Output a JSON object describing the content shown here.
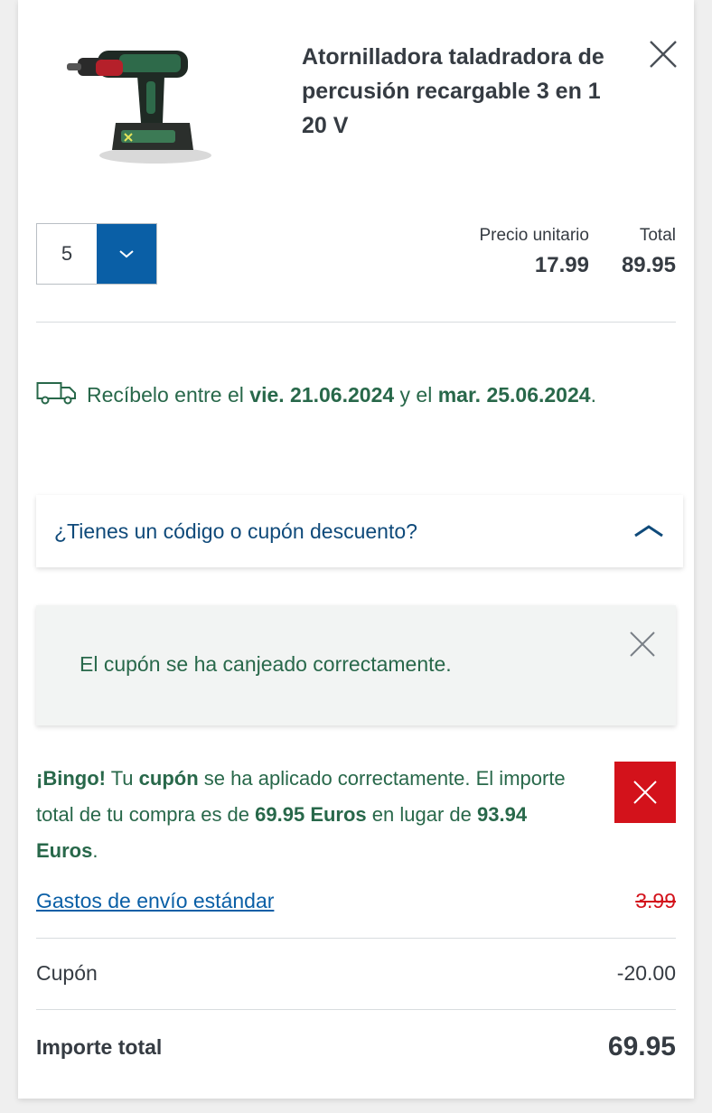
{
  "product": {
    "title": "Atornilladora taladradora de percusión recargable 3 en 1 20 V",
    "image_icon": "drill-product-image"
  },
  "quantity": {
    "value": "5"
  },
  "prices": {
    "unit_label": "Precio unitario",
    "unit_value": "17.99",
    "total_label": "Total",
    "total_value": "89.95"
  },
  "delivery": {
    "prefix": "Recíbelo entre el",
    "date_from": "vie. 21.06.2024",
    "middle": "y el",
    "date_to": "mar. 25.06.2024",
    "suffix": "."
  },
  "coupon_toggle": {
    "label": "¿Tienes un código o cupón descuento?"
  },
  "success_message": {
    "text": "El cupón se ha canjeado correctamente."
  },
  "bingo": {
    "bingo_word": "¡Bingo!",
    "part1": "Tu",
    "cupon_word": "cupón",
    "part2": "se ha aplicado correctamente. El importe total de tu compra es de",
    "new_amount": "69.95 Euros",
    "part3": "en lugar de",
    "old_amount": "93.94 Euros",
    "part4": "."
  },
  "summary": {
    "shipping_label": "Gastos de envío estándar",
    "shipping_value": "3.99",
    "coupon_label": "Cupón",
    "coupon_value": "-20.00",
    "total_label": "Importe total",
    "total_value": "69.95"
  },
  "colors": {
    "accent_blue": "#0a5fa6",
    "success_green": "#28684a",
    "danger_red": "#d3121b"
  }
}
